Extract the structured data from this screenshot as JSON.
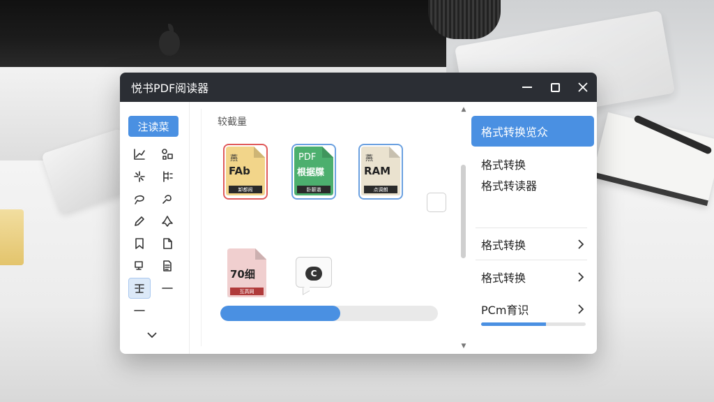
{
  "window": {
    "title": "悦书PDF阅读器"
  },
  "tools": {
    "header": "注读菜",
    "items": [
      {
        "name": "line-chart-icon"
      },
      {
        "name": "shapes-icon"
      },
      {
        "name": "sparkle-icon"
      },
      {
        "name": "tree-icon"
      },
      {
        "name": "lasso-icon"
      },
      {
        "name": "link-icon"
      },
      {
        "name": "pencil-icon"
      },
      {
        "name": "stamp-icon"
      },
      {
        "name": "bookmark-icon"
      },
      {
        "name": "page-curl-icon"
      },
      {
        "name": "image-icon"
      },
      {
        "name": "document-icon"
      },
      {
        "name": "text-frame-icon",
        "active": true
      },
      {
        "name": "dash-icon"
      },
      {
        "name": "minus-icon"
      }
    ]
  },
  "main": {
    "section_label": "较截量",
    "files": [
      {
        "line1": "燕",
        "line2": "FAb",
        "strip": "卸都闹",
        "bg": "#f2d58a",
        "frame": "#e05a5a"
      },
      {
        "line1": "PDF",
        "line2": "根据牒",
        "strip": "卧颤谐",
        "bg": "#4caf6e",
        "frame": "#6aa0e0"
      },
      {
        "line1": "燕",
        "line2": "RAM",
        "strip": "点调朗",
        "bg": "#eae2cf",
        "frame": "#6aa0e0"
      },
      {
        "line1": "",
        "line2": "70细",
        "strip": "互高网",
        "bg": "#f0cfcf",
        "frame": ""
      }
    ],
    "chat_glyph": "C",
    "progress": 0.55
  },
  "right_panel": {
    "primary_button": "格式转换览众",
    "block_line1": "格式转换",
    "block_line2": "格式转读器",
    "items": [
      "格式转换",
      "格式转换",
      "PCm育识"
    ],
    "progress": 0.62
  },
  "colors": {
    "accent": "#4a90e2",
    "titlebar": "#2b2e34"
  }
}
